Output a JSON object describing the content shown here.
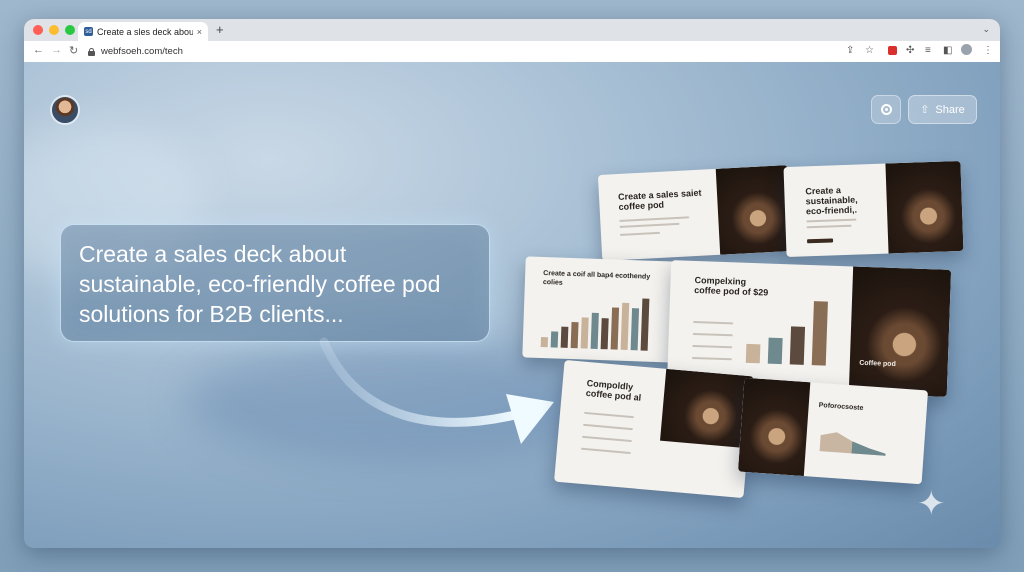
{
  "browser": {
    "tab_title": "Create a sles deck about sus",
    "favicon_text": "sd",
    "tab_close": "×",
    "new_tab": "+",
    "url": "webfsoeh.com/tech",
    "colors": {
      "red": "#ff5f57",
      "yellow": "#febc2e",
      "green": "#28c840"
    }
  },
  "page": {
    "share_label": "Share",
    "prompt_text": "Create a sales deck about sustainable, eco-friendly coffee pod solutions for B2B clients..."
  },
  "slides": {
    "s1_title": "Create a sales saiet coffee pod",
    "s2_title": "Create a sustainable, eco-friendi,.",
    "s3_title": "Create a coif all bap4 ecothendy colies",
    "s4_title": "Compelxing coffee pod of $29",
    "s4_caption": "Coffee pod",
    "s5_title": "Compoldly coffee pod al",
    "s6_title": "Poforocsoste"
  },
  "chart_data": [
    {
      "type": "bar",
      "values": [
        2,
        3,
        4,
        5,
        6,
        7,
        6,
        8,
        9,
        8,
        10
      ]
    },
    {
      "type": "bar",
      "values": [
        3,
        4,
        6,
        10
      ]
    },
    {
      "type": "area",
      "values": [
        4,
        6,
        3,
        2
      ]
    }
  ]
}
